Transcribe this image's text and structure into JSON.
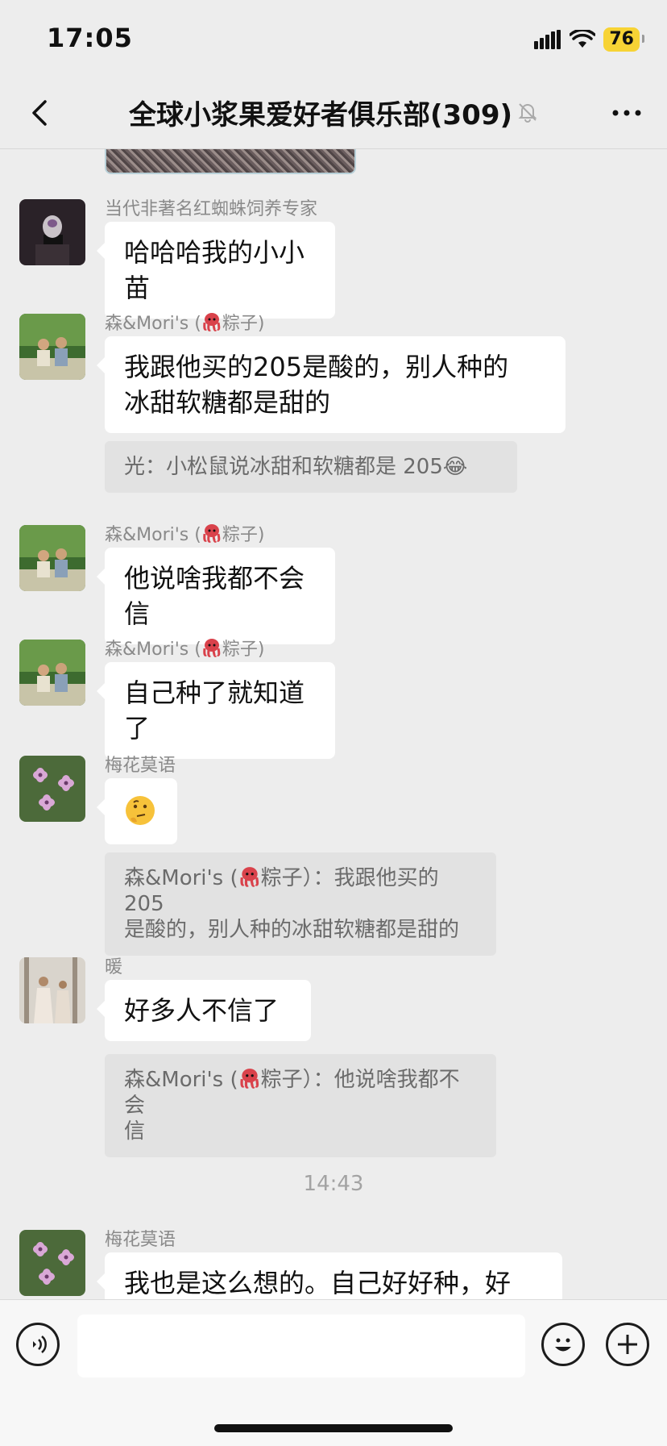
{
  "status_bar": {
    "time": "17:05",
    "battery": "76",
    "battery_color": "#f7d335"
  },
  "nav": {
    "title": "全球小浆果爱好者俱乐部(309)",
    "back_icon": "chevron-left-icon",
    "more_icon": "more-dots-icon",
    "mute_icon": "bell-off-icon"
  },
  "messages": [
    {
      "sender": "当代非著名红蜘蛛饲养专家",
      "text": "哈哈哈我的小小苗"
    },
    {
      "sender_prefix": "森&Mori's (",
      "sender_suffix": "粽子)",
      "text_lines": [
        "我跟他买的205是酸的，别人种的",
        "冰甜软糖都是甜的"
      ],
      "quote": "光：小松鼠说冰甜和软糖都是 205😂"
    },
    {
      "sender_prefix": "森&Mori's (",
      "sender_suffix": "粽子)",
      "text": "他说啥我都不会信"
    },
    {
      "sender_prefix": "森&Mori's (",
      "sender_suffix": "粽子)",
      "text": "自己种了就知道了"
    },
    {
      "sender": "梅花莫语",
      "emoji": "thinking-face-emoji",
      "quote_prefix": "森&Mori's (",
      "quote_suffix_line1": "粽子）：我跟他买的 205",
      "quote_line2": "是酸的，别人种的冰甜软糖都是甜的"
    },
    {
      "sender": "暖",
      "text": "好多人不信了",
      "quote_prefix": "森&Mori's (",
      "quote_suffix_line1": "粽子）：他说啥我都不会",
      "quote_line2": "信"
    },
    {
      "sender": "梅花莫语",
      "text": "我也是这么想的。自己好好种，好"
    }
  ],
  "timestamp": "14:43",
  "input": {
    "value": "",
    "placeholder": ""
  },
  "colors": {
    "background": "#ededed",
    "bubble": "#ffffff",
    "quote": "#e2e2e2",
    "sender": "#8a8a8a"
  }
}
